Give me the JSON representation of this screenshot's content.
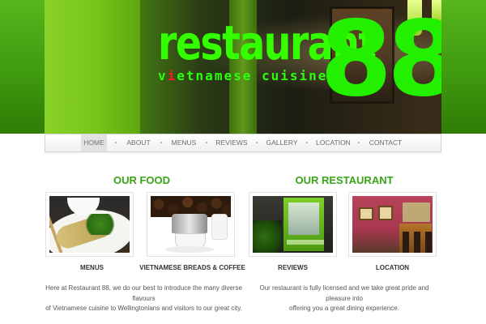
{
  "header": {
    "logo_word": "restaurant",
    "logo_number": "88",
    "tagline_first": "v",
    "tagline_red": "i",
    "tagline_rest": "etnamese cuisine"
  },
  "nav": {
    "items": [
      "HOME",
      "ABOUT",
      "MENUS",
      "REVIEWS",
      "GALLERY",
      "LOCATION",
      "CONTACT"
    ],
    "active": "HOME"
  },
  "sections": {
    "food": {
      "title": "OUR FOOD",
      "cards": [
        {
          "caption": "MENUS",
          "image": "food-plate-image"
        },
        {
          "caption": "VIETNAMESE BREADS & COFFEE",
          "image": "coffee-filter-image"
        }
      ],
      "text_line1": "Here at Restaurant 88, we do our best to introduce the many diverse flavours",
      "text_line2": "of Vietnamese cuisine to Wellingtonians and visitors to our great city."
    },
    "restaurant": {
      "title": "OUR RESTAURANT",
      "cards": [
        {
          "caption": "REVIEWS",
          "image": "storefront-image"
        },
        {
          "caption": "LOCATION",
          "image": "interior-image"
        }
      ],
      "text_line1": "Our restaurant is fully licensed and we take great pride and pleasure into",
      "text_line2": "offering you a great dining experience."
    }
  },
  "colors": {
    "brand_green": "#3aa514",
    "logo_green": "#33ff00",
    "accent_red": "#ff1a1a",
    "band_green": "#4aa916"
  }
}
